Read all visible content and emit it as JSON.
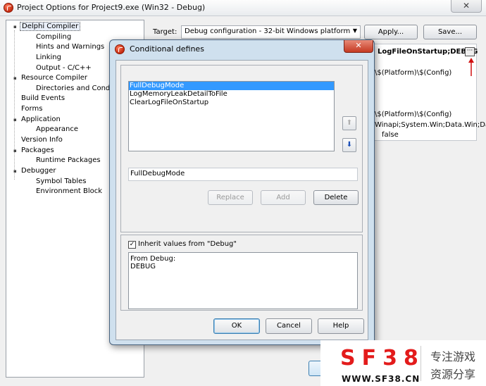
{
  "window": {
    "title": "Project Options for Project9.exe  (Win32 - Debug)",
    "close_glyph": "✕"
  },
  "tree": {
    "items": [
      {
        "label": "Delphi Compiler",
        "expander": "▪"
      },
      {
        "label": "Compiling",
        "expander": ""
      },
      {
        "label": "Hints and Warnings",
        "expander": ""
      },
      {
        "label": "Linking",
        "expander": ""
      },
      {
        "label": "Output - C/C++",
        "expander": ""
      },
      {
        "label": "Resource Compiler",
        "expander": "▪"
      },
      {
        "label": "Directories and Conditio",
        "expander": ""
      },
      {
        "label": "Build Events",
        "expander": ""
      },
      {
        "label": "Forms",
        "expander": ""
      },
      {
        "label": "Application",
        "expander": "▪"
      },
      {
        "label": "Appearance",
        "expander": ""
      },
      {
        "label": "Version Info",
        "expander": ""
      },
      {
        "label": "Packages",
        "expander": "▪"
      },
      {
        "label": "Runtime Packages",
        "expander": ""
      },
      {
        "label": "Debugger",
        "expander": "▪"
      },
      {
        "label": "Symbol Tables",
        "expander": ""
      },
      {
        "label": "Environment Block",
        "expander": ""
      }
    ]
  },
  "target": {
    "label": "Target:",
    "value": "Debug configuration - 32-bit Windows platform",
    "arrow": "▼",
    "apply_label": "Apply...",
    "save_label": "Save..."
  },
  "properties": {
    "fragments": [
      "LogFileOnStartup;DEBUG",
      "\\$(Platform)\\$(Config)",
      "\\$(Platform)\\$(Config)",
      "Winapi;System.Win;Data.Win;Da",
      "false"
    ],
    "ellipsis": "···"
  },
  "dialog": {
    "title": "Conditional defines",
    "close_glyph": "✕",
    "defines": [
      "FullDebugMode",
      "LogMemoryLeakDetailToFile",
      "ClearLogFileOnStartup"
    ],
    "move_up_glyph": "⬆",
    "move_down_glyph": "⬇",
    "edit_value": "FullDebugMode",
    "replace_label": "Replace",
    "add_label": "Add",
    "delete_label": "Delete",
    "inherit_checked_glyph": "✓",
    "inherit_label": "Inherit values from \"Debug\"",
    "inherited_lines": [
      "From Debug:",
      "DEBUG"
    ],
    "ok_label": "OK",
    "cancel_label": "Cancel",
    "help_label": "Help"
  },
  "watermark": {
    "brand": "SF38",
    "url": "WWW.SF38.CN",
    "tag1": "专注游戏",
    "tag2": "资源分享"
  },
  "colors": {
    "selection": "#3399ff",
    "title_close": "#c53a22",
    "brand_red": "#e31b1b"
  }
}
